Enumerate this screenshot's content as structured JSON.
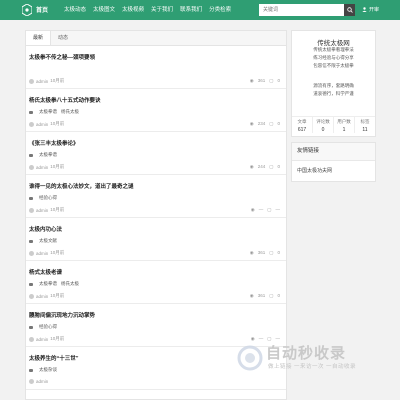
{
  "header": {
    "brand": "首页",
    "nav": [
      "太极动态",
      "太极图文",
      "太极视频",
      "关于我们",
      "联系我们",
      "分类检索"
    ],
    "search_placeholder": "关键词",
    "user_label": "开审"
  },
  "tabs": [
    "最新",
    "动态"
  ],
  "articles": [
    {
      "title": "太极拳不传之秘—颈项要领",
      "tags": [],
      "author": "admin",
      "time": "10月前",
      "views": "361",
      "comments": "0"
    },
    {
      "title": "杨氏太极拳八十五式动作要诀",
      "tags": [
        "太极拳谱",
        "杨氏太极"
      ],
      "author": "admin",
      "time": "10月前",
      "views": "234",
      "comments": "0"
    },
    {
      "title": "《张三丰太极拳论》",
      "tags": [
        "太极拳谱"
      ],
      "author": "admin",
      "time": "10月前",
      "views": "244",
      "comments": "0"
    },
    {
      "title": "谁得一见的太极心法妙文，道出了最奇之谜",
      "tags": [
        "经验心得"
      ],
      "author": "admin",
      "time": "10月前",
      "views": "—",
      "comments": "—"
    },
    {
      "title": "太极内功心法",
      "tags": [
        "太极文献"
      ],
      "author": "admin",
      "time": "10月前",
      "views": "361",
      "comments": "0"
    },
    {
      "title": "杨式太极老谱",
      "tags": [
        "太极拳谱",
        "杨氏太极"
      ],
      "author": "admin",
      "time": "10月前",
      "views": "361",
      "comments": "0"
    },
    {
      "title": "腰胯间偏沉现地力沉动掌势",
      "tags": [
        "经验心得"
      ],
      "author": "admin",
      "time": "10月前",
      "views": "—",
      "comments": "—"
    },
    {
      "title": "太极养生的“十三世”",
      "tags": [
        "太极杂谈"
      ],
      "author": "admin",
      "time": "",
      "views": "",
      "comments": ""
    }
  ],
  "sidebar": {
    "site_name": "传统太极网",
    "poem": [
      "传统太极拳看理拳法",
      "练习经验与心得分享",
      "包容信不限于太极拳",
      "",
      "源流有序，套路明确",
      "道衷德行，科学严谨"
    ],
    "stats": [
      {
        "label": "文章",
        "value": "617"
      },
      {
        "label": "评论数",
        "value": "0"
      },
      {
        "label": "用户数",
        "value": "1"
      },
      {
        "label": "标签",
        "value": "11"
      }
    ],
    "links_title": "友情链接",
    "links": [
      "中国太极功夫网"
    ]
  },
  "watermark": {
    "text": "自动秒收录",
    "sub": "做上链接 一来访一次 一自动收录"
  }
}
